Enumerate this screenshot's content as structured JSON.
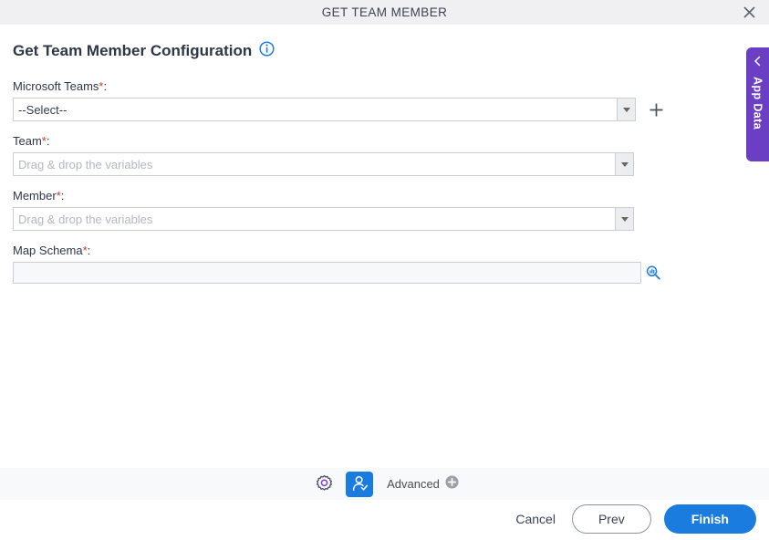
{
  "window": {
    "title": "GET TEAM MEMBER",
    "close_icon": "close-icon"
  },
  "page": {
    "heading": "Get Team Member Configuration",
    "info_icon": "info-circle-icon"
  },
  "form": {
    "fields": [
      {
        "label": "Microsoft Teams",
        "required": "*",
        "colon": ":",
        "value": "--Select--",
        "type": "select-with-add",
        "add_icon": "plus-icon"
      },
      {
        "label": "Team",
        "required": "*",
        "colon": ":",
        "placeholder": "Drag & drop the variables",
        "type": "select"
      },
      {
        "label": "Member",
        "required": "*",
        "colon": ":",
        "placeholder": "Drag & drop the variables",
        "type": "select"
      },
      {
        "label": "Map Schema",
        "required": "*",
        "colon": ":",
        "value": "",
        "type": "text-with-search",
        "search_icon": "schema-search-icon"
      }
    ]
  },
  "app_data_tab": {
    "label": "App Data",
    "chevron_icon": "chevron-left-icon",
    "color": "#6b3fc4"
  },
  "toolbar": {
    "settings_icon": "gear-icon",
    "identity_icon": "person-check-icon",
    "advanced_label": "Advanced",
    "advanced_add_icon": "circle-plus-icon",
    "active_color": "#1b7ce0"
  },
  "actions": {
    "cancel": "Cancel",
    "prev": "Prev",
    "finish": "Finish",
    "primary_color": "#1b7ce0"
  }
}
